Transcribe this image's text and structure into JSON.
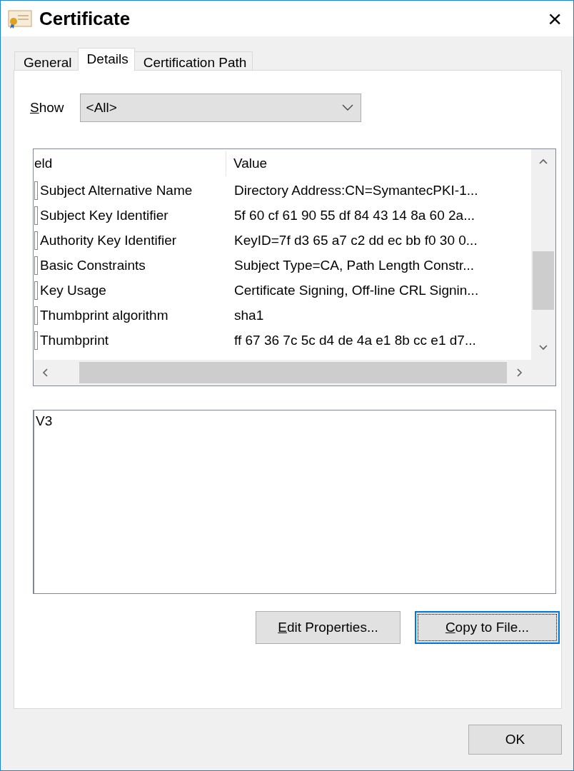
{
  "window": {
    "title": "Certificate",
    "close": "×"
  },
  "tabs": [
    {
      "label": "General",
      "selected": false
    },
    {
      "label": "Details",
      "selected": true
    },
    {
      "label": "Certification Path",
      "selected": false
    }
  ],
  "show": {
    "label": "Show",
    "value": "<All>"
  },
  "table": {
    "columns": [
      "eld",
      "Value"
    ],
    "rows": [
      {
        "field": "Subject Alternative Name",
        "value": "Directory Address:CN=SymantecPKI-1..."
      },
      {
        "field": "Subject Key Identifier",
        "value": "5f 60 cf 61 90 55 df 84 43 14 8a 60 2a..."
      },
      {
        "field": "Authority Key Identifier",
        "value": "KeyID=7f d3 65 a7 c2 dd ec bb f0 30 0..."
      },
      {
        "field": "Basic Constraints",
        "value": "Subject Type=CA, Path Length Constr..."
      },
      {
        "field": "Key Usage",
        "value": "Certificate Signing, Off-line CRL Signin..."
      },
      {
        "field": "Thumbprint algorithm",
        "value": "sha1"
      },
      {
        "field": "Thumbprint",
        "value": "ff 67 36 7c 5c d4 de 4a e1 8b cc e1 d7..."
      }
    ]
  },
  "detail": {
    "value": "V3"
  },
  "buttons": [
    {
      "label": "Edit Properties...",
      "focused": false
    },
    {
      "label": "Copy to File...",
      "focused": true
    }
  ],
  "ok_button": {
    "label": "OK"
  }
}
